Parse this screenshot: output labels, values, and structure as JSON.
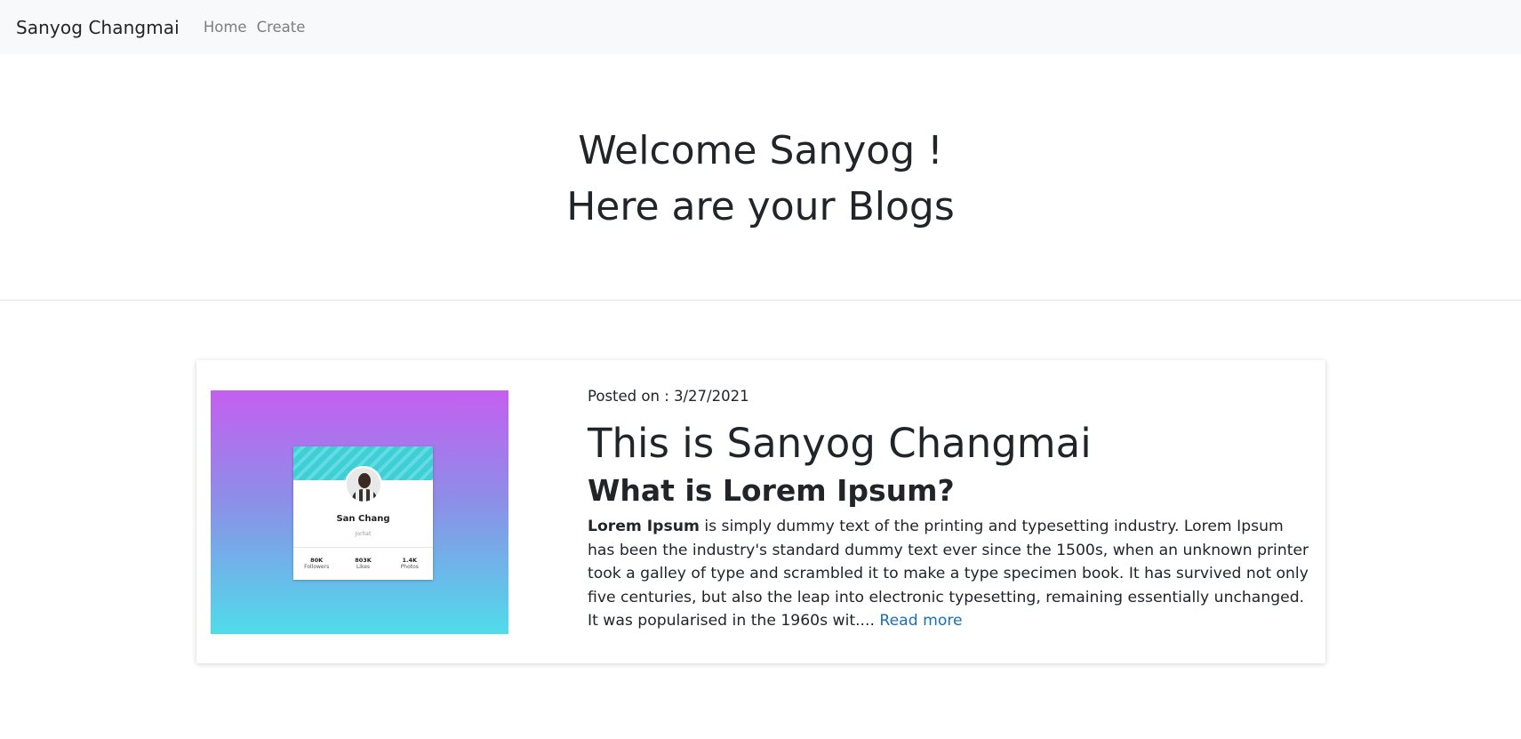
{
  "navbar": {
    "brand": "Sanyog Changmai",
    "links": [
      "Home",
      "Create"
    ]
  },
  "hero": {
    "line1": "Welcome Sanyog !",
    "line2": "Here are your Blogs"
  },
  "post": {
    "posted_on": "Posted on : 3/27/2021",
    "title": "This is Sanyog Changmai",
    "subtitle": "What is Lorem Ipsum?",
    "body_lead": "Lorem Ipsum",
    "body_rest": " is simply dummy text of the printing and typesetting industry. Lorem Ipsum has been the industry's standard dummy text ever since the 1500s, when an unknown printer took a galley of type and scrambled it to make a type specimen book. It has survived not only five centuries, but also the leap into electronic typesetting, remaining essentially unchanged. It was popularised in the 1960s wit.... ",
    "read_more": "Read more",
    "thumbnail": {
      "name": "San Chang",
      "location": "Jorhat",
      "stats": [
        {
          "value": "80K",
          "label": "Followers"
        },
        {
          "value": "803K",
          "label": "Likes"
        },
        {
          "value": "1.4K",
          "label": "Photos"
        }
      ]
    }
  },
  "colors": {
    "navbar_bg": "#f8f9fa",
    "link": "#1a6fb5",
    "gradient_top": "#c45ff0",
    "gradient_bottom": "#4fdcea"
  }
}
